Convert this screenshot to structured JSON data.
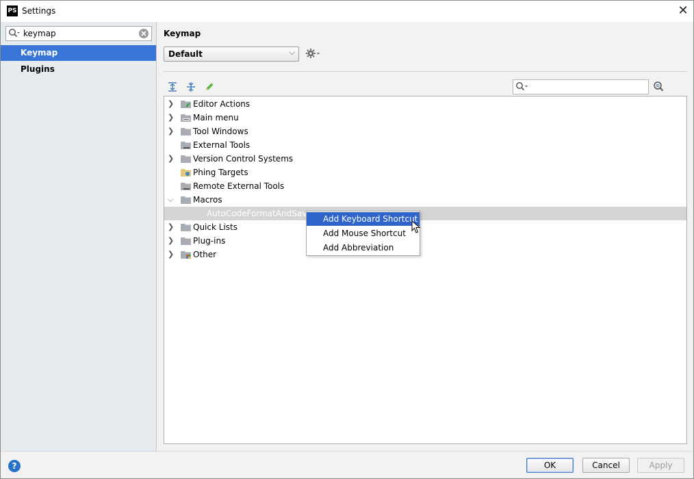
{
  "window": {
    "title": "Settings",
    "app_icon_text": "PS"
  },
  "sidebar": {
    "search_value": "keymap",
    "items": [
      {
        "label": "Keymap",
        "selected": true
      },
      {
        "label": "Plugins",
        "selected": false
      }
    ]
  },
  "main": {
    "title": "Keymap",
    "scheme_value": "Default",
    "tree": [
      {
        "label": "Editor Actions",
        "expandable": true,
        "icon": "folder-action-icon"
      },
      {
        "label": "Main menu",
        "expandable": true,
        "icon": "folder-menu-icon"
      },
      {
        "label": "Tool Windows",
        "expandable": true,
        "icon": "folder-icon"
      },
      {
        "label": "External Tools",
        "expandable": false,
        "icon": "folder-tools-icon"
      },
      {
        "label": "Version Control Systems",
        "expandable": true,
        "icon": "folder-icon"
      },
      {
        "label": "Phing Targets",
        "expandable": false,
        "icon": "phing-icon"
      },
      {
        "label": "Remote External Tools",
        "expandable": false,
        "icon": "folder-tools-icon"
      },
      {
        "label": "Macros",
        "expandable": true,
        "expanded": true,
        "icon": "folder-icon"
      },
      {
        "label": "AutoCodeFormatAndSave",
        "child": true,
        "selected": true
      },
      {
        "label": "Quick Lists",
        "expandable": true,
        "icon": "folder-icon"
      },
      {
        "label": "Plug-ins",
        "expandable": true,
        "icon": "folder-icon"
      },
      {
        "label": "Other",
        "expandable": true,
        "icon": "folder-other-icon"
      }
    ]
  },
  "context_menu": {
    "items": [
      {
        "label": "Add Keyboard Shortcut",
        "active": true
      },
      {
        "label": "Add Mouse Shortcut",
        "active": false
      },
      {
        "label": "Add Abbreviation",
        "active": false
      }
    ]
  },
  "footer": {
    "help_label": "?",
    "ok_label": "OK",
    "cancel_label": "Cancel",
    "apply_label": "Apply"
  },
  "colors": {
    "selection": "#3875d7",
    "menu_active": "#2f65ca",
    "sidebar_bg": "#e6ebf0"
  }
}
